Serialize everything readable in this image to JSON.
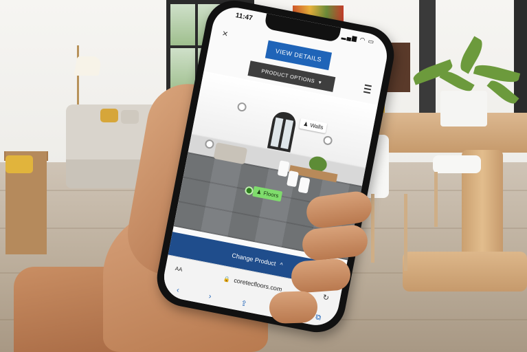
{
  "status_bar": {
    "time": "11:47",
    "icons": "▂▄▆ ◠ ▭"
  },
  "header": {
    "close_glyph": "×",
    "view_details_label": "VIEW DETAILS",
    "product_options_label": "PRODUCT OPTIONS",
    "product_options_caret": "▾"
  },
  "room_view": {
    "walls_tag": "Walls",
    "floors_tag": "Floors",
    "person_glyph": "♟"
  },
  "bottom_panel": {
    "change_product_label": "Change Product",
    "change_product_caret": "^",
    "ar_glyph": "⛶"
  },
  "browser": {
    "text_size_label": "AA",
    "lock_glyph": "🔒",
    "url": "coretecfloors.com",
    "reload_glyph": "↻",
    "toolbar_icons": [
      "‹",
      "›",
      "⇪",
      "📖",
      "⧉"
    ]
  },
  "colors": {
    "primary_blue": "#1f64b8",
    "panel_blue": "#1f4d8c",
    "floors_tag_green": "#7fdc6c",
    "dark_button": "#3e3e3e"
  }
}
